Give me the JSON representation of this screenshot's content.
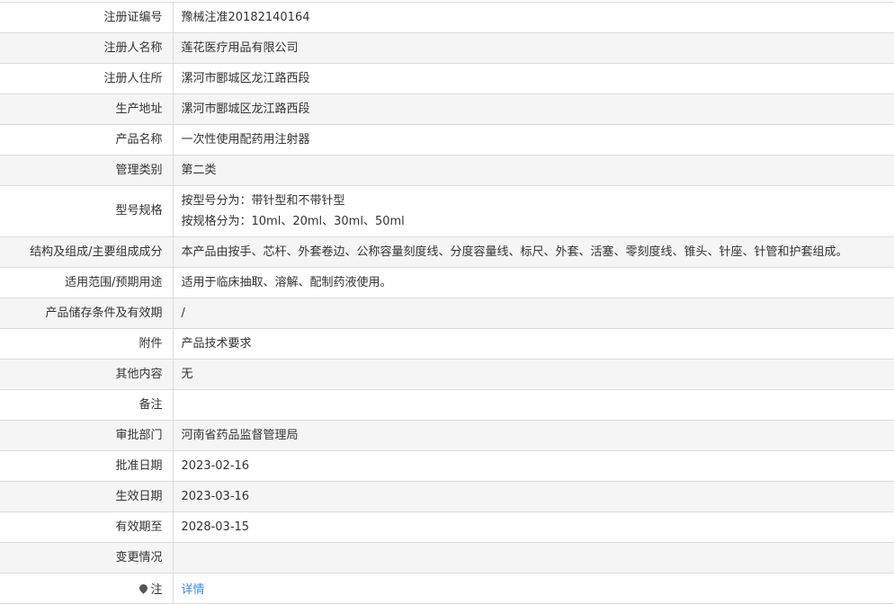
{
  "rows": [
    {
      "label": "注册证编号",
      "value": "豫械注准20182140164"
    },
    {
      "label": "注册人名称",
      "value": "莲花医疗用品有限公司"
    },
    {
      "label": "注册人住所",
      "value": "漯河市郾城区龙江路西段"
    },
    {
      "label": "生产地址",
      "value": "漯河市郾城区龙江路西段"
    },
    {
      "label": "产品名称",
      "value": "一次性使用配药用注射器"
    },
    {
      "label": "管理类别",
      "value": "第二类"
    },
    {
      "label": "型号规格",
      "lines": [
        "按型号分为：带针型和不带针型",
        "按规格分为：10ml、20ml、30ml、50ml"
      ]
    },
    {
      "label": "结构及组成/主要组成成分",
      "value": "本产品由按手、芯杆、外套卷边、公称容量刻度线、分度容量线、标尺、外套、活塞、零刻度线、锥头、针座、针管和护套组成。"
    },
    {
      "label": "适用范围/预期用途",
      "value": "适用于临床抽取、溶解、配制药液使用。"
    },
    {
      "label": "产品储存条件及有效期",
      "value": "/"
    },
    {
      "label": "附件",
      "value": "产品技术要求"
    },
    {
      "label": "其他内容",
      "value": "无"
    },
    {
      "label": "备注",
      "value": ""
    },
    {
      "label": "审批部门",
      "value": "河南省药品监督管理局"
    },
    {
      "label": "批准日期",
      "value": "2023-02-16"
    },
    {
      "label": "生效日期",
      "value": "2023-03-16"
    },
    {
      "label": "有效期至",
      "value": "2028-03-15"
    },
    {
      "label": "变更情况",
      "value": ""
    }
  ],
  "note": {
    "label": "注",
    "link": "详情",
    "icon": "pin-icon"
  }
}
